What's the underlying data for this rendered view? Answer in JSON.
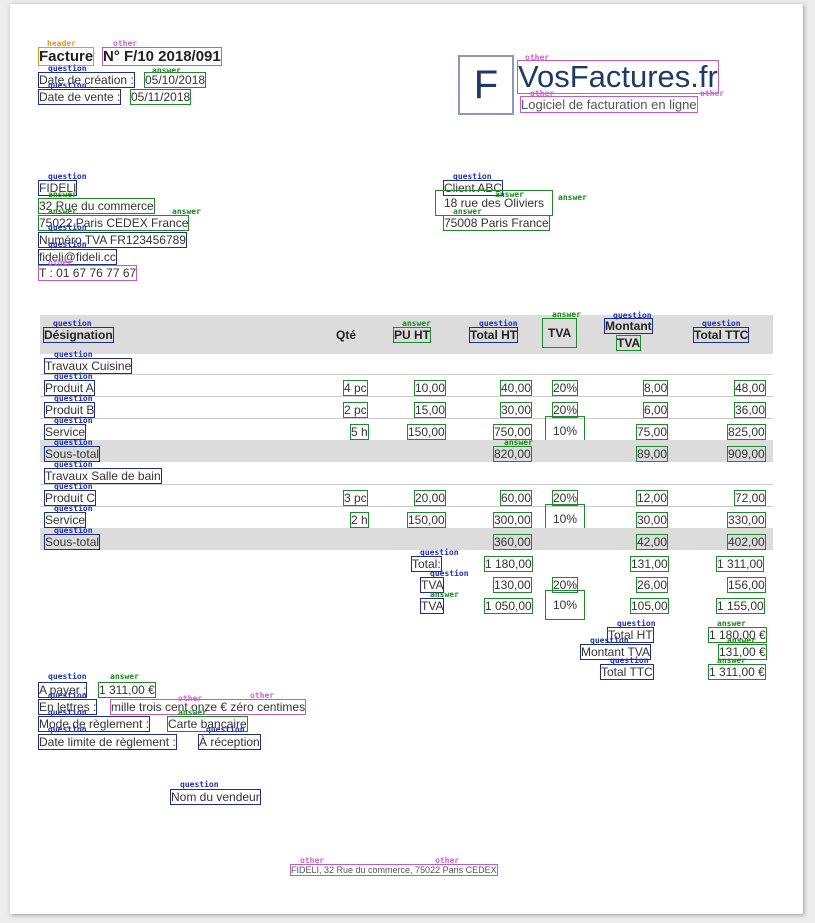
{
  "header": {
    "label": "Facture",
    "number": "N° F/10 2018/091",
    "creation_label": "Date de création :",
    "creation_date": "05/10/2018",
    "sale_label": "Date de vente :",
    "sale_date": "05/11/2018"
  },
  "brand": {
    "logo_letter": "F",
    "name": "VosFactures.fr",
    "tagline": "Logiciel de facturation en ligne"
  },
  "seller": {
    "name": "FIDELI",
    "address": "32 Rue du commerce",
    "city": "75022 Paris CEDEX France",
    "vat": "Numéro TVA FR123456789",
    "email": "fideli@fideli.cc",
    "phone": "T : 01 67 76 77 67"
  },
  "client": {
    "name": "Client ABC",
    "address": "18 rue des Oliviers",
    "city": "75008 Paris France"
  },
  "table": {
    "headers": {
      "designation": "Désignation",
      "qty": "Qté",
      "pu_ht": "PU HT",
      "total_ht": "Total HT",
      "tva": "TVA",
      "montant": "Montant",
      "montant_tva": "TVA",
      "total_ttc": "Total TTC"
    },
    "group1": {
      "title": "Travaux Cuisine",
      "rows": [
        {
          "name": "Produit A",
          "qty": "4 pc",
          "pu": "10,00",
          "ht": "40,00",
          "tva": "20%",
          "mt": "8,00",
          "ttc": "48,00"
        },
        {
          "name": "Produit B",
          "qty": "2 pc",
          "pu": "15,00",
          "ht": "30,00",
          "tva": "20%",
          "mt": "6,00",
          "ttc": "36,00"
        },
        {
          "name": "Service",
          "qty": "5 h",
          "pu": "150,00",
          "ht": "750,00",
          "tva": "10%",
          "mt": "75,00",
          "ttc": "825,00"
        }
      ],
      "subtotal": {
        "label": "Sous-total",
        "ht": "820,00",
        "mt": "89,00",
        "ttc": "909,00"
      }
    },
    "group2": {
      "title": "Travaux Salle de bain",
      "rows": [
        {
          "name": "Produit C",
          "qty": "3 pc",
          "pu": "20,00",
          "ht": "60,00",
          "tva": "20%",
          "mt": "12,00",
          "ttc": "72,00"
        },
        {
          "name": "Service",
          "qty": "2 h",
          "pu": "150,00",
          "ht": "300,00",
          "tva": "10%",
          "mt": "30,00",
          "ttc": "330,00"
        }
      ],
      "subtotal": {
        "label": "Sous-total",
        "ht": "360,00",
        "mt": "42,00",
        "ttc": "402,00"
      }
    },
    "totals": {
      "label": "Total:",
      "ht": "1 180,00",
      "mt": "131,00",
      "ttc": "1 311,00",
      "tva_rows": [
        {
          "label": "TVA",
          "ht": "130,00",
          "rate": "20%",
          "mt": "26,00",
          "ttc": "156,00"
        },
        {
          "label": "TVA",
          "ht": "1 050,00",
          "rate": "10%",
          "mt": "105,00",
          "ttc": "1 155,00"
        }
      ]
    }
  },
  "summary": {
    "total_ht_label": "Total HT",
    "total_ht": "1 180,00 €",
    "montant_tva_label": "Montant TVA",
    "montant_tva": "131,00 €",
    "total_ttc_label": "Total TTC",
    "total_ttc": "1 311,00 €"
  },
  "payment": {
    "due_label": "A payer :",
    "due_value": "1 311,00 €",
    "words_label": "En lettres :",
    "words_value": "mille trois cent onze € zéro centimes",
    "method_label": "Mode de règlement :",
    "method_value": "Carte bancaire",
    "deadline_label": "Date limite de règlement :",
    "deadline_value": "À réception"
  },
  "seller_sign": "Nom du vendeur",
  "footer": "FIDELI, 32 Rue du commerce, 75022 Paris CEDEX",
  "tags": {
    "q": "question",
    "a": "answer",
    "o": "other",
    "h": "header"
  },
  "colors": {
    "question": "#1c2ec8",
    "answer": "#1a8a1a",
    "other": "#d060d8",
    "header": "#e59a25",
    "table_bg": "#dcdcdc"
  }
}
